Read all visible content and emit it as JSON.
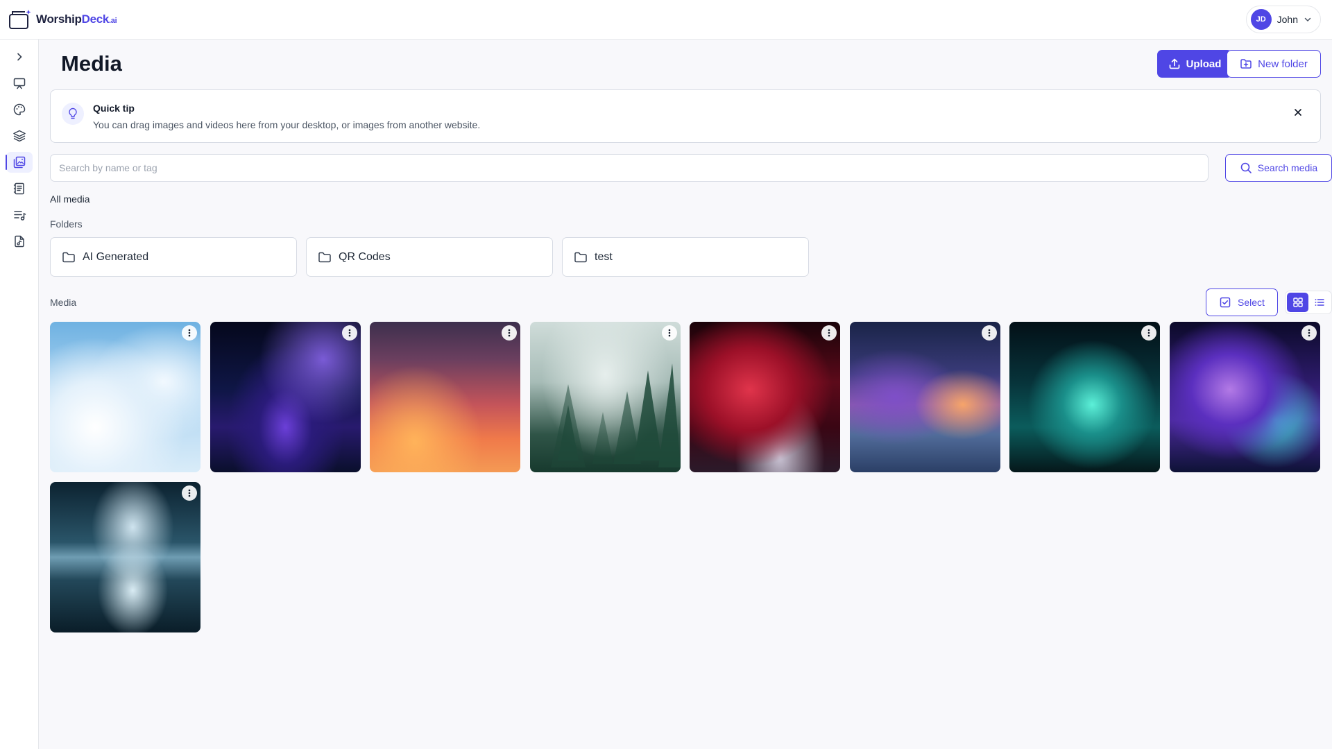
{
  "app": {
    "logo_main": "Worship",
    "logo_accent": "Deck",
    "logo_suffix": ".ai",
    "brand_color": "#4f46e5"
  },
  "user": {
    "initials": "JD",
    "name": "John"
  },
  "sidebar": {
    "items": [
      {
        "name": "expand-icon"
      },
      {
        "name": "presentation-icon"
      },
      {
        "name": "palette-icon"
      },
      {
        "name": "layers-icon"
      },
      {
        "name": "media-icon",
        "active": true
      },
      {
        "name": "songbook-icon"
      },
      {
        "name": "playlist-icon"
      },
      {
        "name": "music-file-icon"
      }
    ]
  },
  "page": {
    "title": "Media",
    "upload_label": "Upload",
    "new_folder_label": "New folder"
  },
  "tip": {
    "title": "Quick tip",
    "body": "You can drag images and videos here from your desktop, or images from another website."
  },
  "search": {
    "placeholder": "Search by name or tag",
    "button_label": "Search media"
  },
  "breadcrumb": "All media",
  "folders": {
    "heading": "Folders",
    "items": [
      {
        "label": "AI Generated"
      },
      {
        "label": "QR Codes"
      },
      {
        "label": "test"
      }
    ]
  },
  "media": {
    "heading": "Media",
    "select_label": "Select",
    "view_mode": "grid",
    "items": [
      {
        "name": "clouds-sky-image"
      },
      {
        "name": "galaxy-night-image"
      },
      {
        "name": "sunset-clouds-image"
      },
      {
        "name": "misty-forest-image"
      },
      {
        "name": "red-clouds-image"
      },
      {
        "name": "purple-sunset-clouds-image"
      },
      {
        "name": "aurora-image"
      },
      {
        "name": "purple-nebula-image"
      },
      {
        "name": "lake-reflection-image"
      }
    ]
  }
}
